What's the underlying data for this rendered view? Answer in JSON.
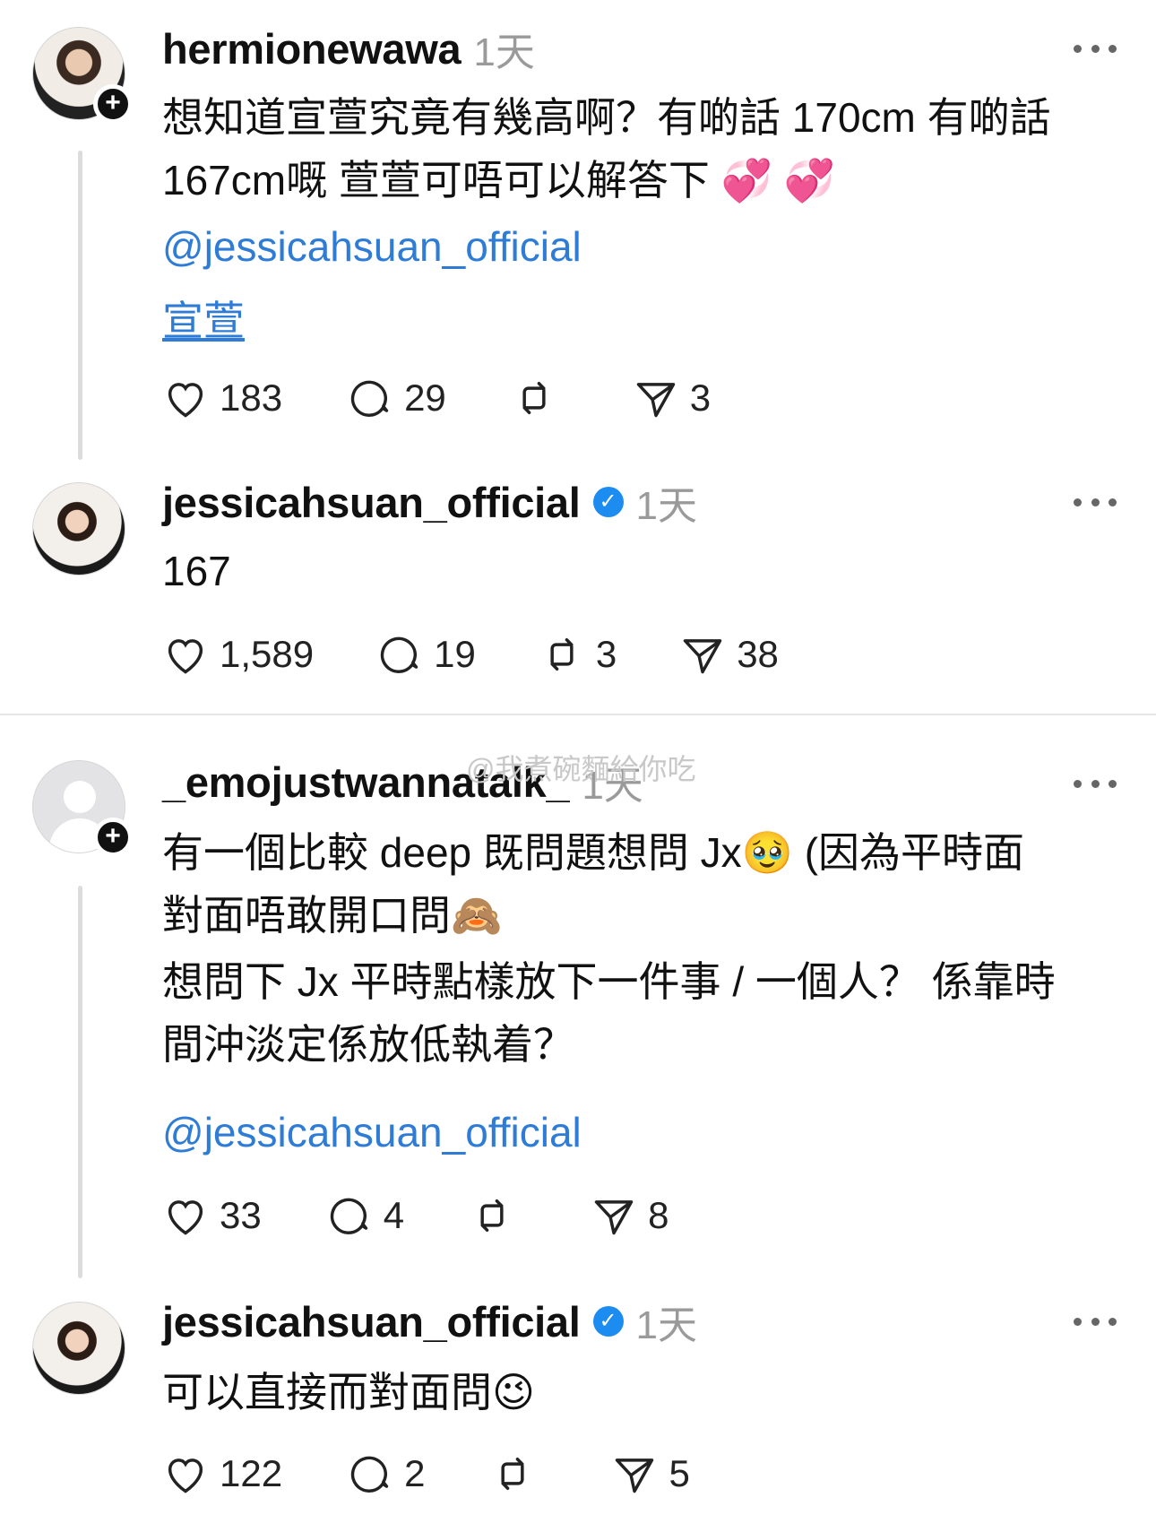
{
  "posts": [
    {
      "username": "hermionewawa",
      "time": "1天",
      "text_lines": [
        "想知道宣萱究竟有幾高啊？有啲話 170cm 有啲話",
        "167cm嘅 萱萱可唔可以解答下 💞 💞"
      ],
      "mention": "@jessicahsuan_official",
      "mention2": "宣萱",
      "likes": "183",
      "comments": "29",
      "reposts": "",
      "shares": "3"
    },
    {
      "username": "jessicahsuan_official",
      "time": "1天",
      "verified": true,
      "text": "167",
      "likes": "1,589",
      "comments": "19",
      "reposts": "3",
      "shares": "38"
    },
    {
      "username": "_emojustwannatalk_",
      "time": "1天",
      "text_lines": [
        "有一個比較 deep 既問題想問 Jx🥹 (因為平時面",
        "對面唔敢開口問🙈",
        "想問下 Jx 平時點樣放下一件事 / 一個人？ 係靠時",
        "間沖淡定係放低執着？"
      ],
      "mention": "@jessicahsuan_official",
      "likes": "33",
      "comments": "4",
      "reposts": "",
      "shares": "8"
    },
    {
      "username": "jessicahsuan_official",
      "time": "1天",
      "verified": true,
      "text": "可以直接而對面問😉",
      "likes": "122",
      "comments": "2",
      "reposts": "",
      "shares": "5"
    }
  ],
  "watermark": "@我煮碗麵給你吃",
  "icons": {
    "like": "heart-icon",
    "comment": "comment-bubble-icon",
    "repost": "repost-icon",
    "share": "send-icon",
    "more": "more-dots-icon",
    "verified": "verified-badge-icon",
    "follow": "plus-icon"
  }
}
